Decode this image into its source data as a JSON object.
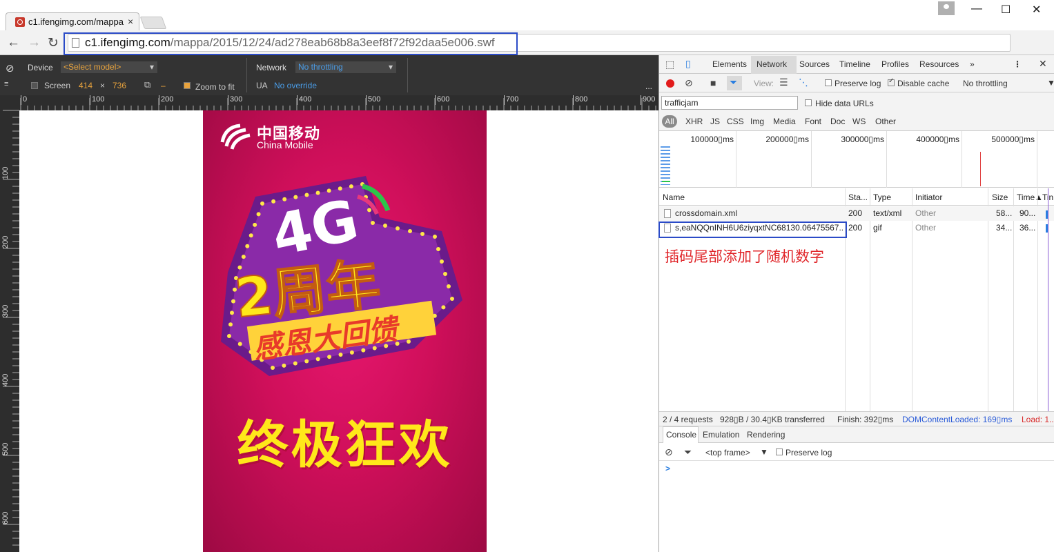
{
  "browser": {
    "tab_title": "c1.ifengimg.com/mappa",
    "tab_close": "×",
    "url_host": "c1.ifengimg.com",
    "url_path": "/mappa/2015/12/24/ad278eab68b8a3eef8f72f92daa5e006.swf",
    "window_min": "—",
    "window_max": "☐",
    "window_close": "✕",
    "ext_label": "客"
  },
  "device_toolbar": {
    "device_label": "Device",
    "model_select": "<Select model>",
    "screen_label": "Screen",
    "width": "414",
    "times": "×",
    "height": "736",
    "dash": "–",
    "zoom_label": "Zoom to fit",
    "network_label": "Network",
    "throttle_select": "No throttling",
    "ua_label": "UA",
    "ua_value": "No override",
    "more": "..."
  },
  "rulers": {
    "h": [
      "0",
      "100",
      "200",
      "300",
      "400",
      "500",
      "600",
      "700",
      "800",
      "900"
    ],
    "v": [
      "100",
      "200",
      "300",
      "400",
      "500",
      "600"
    ]
  },
  "ad": {
    "logo_cn": "中国移动",
    "logo_en": "China Mobile",
    "badge_4g": "4G",
    "badge_2": "2周年",
    "badge_sub": "感恩大回馈",
    "slogan": "终极狂欢"
  },
  "devtools": {
    "tabs": [
      "Elements",
      "Network",
      "Sources",
      "Timeline",
      "Profiles",
      "Resources"
    ],
    "more_tabs": "»",
    "preserve_log": "Preserve log",
    "disable_cache": "Disable cache",
    "no_throttling": "No throttling",
    "view_label": "View:",
    "filter_value": "trafficjam",
    "hide_data_urls": "Hide data URLs",
    "types": [
      "All",
      "XHR",
      "JS",
      "CSS",
      "Img",
      "Media",
      "Font",
      "Doc",
      "WS",
      "Other"
    ],
    "overview_ticks": [
      "100000▯ms",
      "200000▯ms",
      "300000▯ms",
      "400000▯ms",
      "500000▯ms"
    ],
    "columns": [
      "Name",
      "Sta...",
      "Type",
      "Initiator",
      "Size",
      "Time",
      "Tin"
    ],
    "rows": [
      {
        "name": "crossdomain.xml",
        "status": "200",
        "type": "text/xml",
        "initiator": "Other",
        "size": "58...",
        "time": "90..."
      },
      {
        "name": "s,eaNQQnINH6U6ziyqxtNC68130.06475567...",
        "status": "200",
        "type": "gif",
        "initiator": "Other",
        "size": "34...",
        "time": "36..."
      }
    ],
    "annotation": "插码尾部添加了随机数字",
    "status_requests": "2 / 4 requests",
    "status_transferred": "928▯B / 30.4▯KB transferred",
    "status_finish": "Finish: 392▯ms",
    "status_dcl": "DOMContentLoaded: 169▯ms",
    "status_load": "Load: 1...",
    "drawer_tabs": [
      "Console",
      "Emulation",
      "Rendering"
    ],
    "frame_select": "<top frame>",
    "console_preserve": "Preserve log",
    "prompt": ">"
  },
  "colors": {
    "accent": "#2b4bc7",
    "annotation": "#e0262a",
    "ad_bg": "#d0105b",
    "slogan": "#ffe81a"
  }
}
